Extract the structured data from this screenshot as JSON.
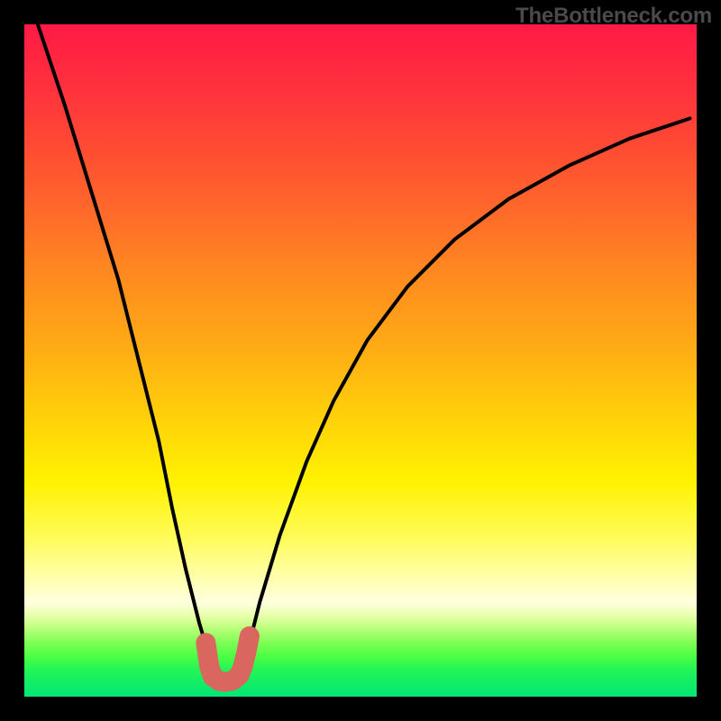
{
  "watermark": "TheBottleneck.com",
  "colors": {
    "curve": "#000000",
    "marker": "#d9675f",
    "frame": "#000000"
  },
  "chart_data": {
    "type": "line",
    "title": "",
    "xlabel": "",
    "ylabel": "",
    "xlim": [
      0,
      100
    ],
    "ylim": [
      0,
      100
    ],
    "series": [
      {
        "name": "bottleneck-curve",
        "x": [
          2,
          6,
          10,
          14,
          17,
          20,
          22,
          24,
          26,
          27.5,
          29,
          30,
          31,
          32,
          33.5,
          35,
          38,
          42,
          46,
          51,
          57,
          64,
          72,
          81,
          90,
          99
        ],
        "y": [
          100,
          88,
          75,
          62,
          50,
          38,
          28,
          19,
          11,
          6,
          3,
          2.2,
          2.6,
          4,
          8,
          14,
          24,
          35,
          44,
          53,
          61,
          68,
          74,
          79,
          83,
          86
        ]
      },
      {
        "name": "optimal-region-marker",
        "x": [
          27,
          27.5,
          28,
          29,
          30,
          31,
          32,
          32.5,
          33,
          33.5
        ],
        "y": [
          8,
          4.5,
          3,
          2.3,
          2.2,
          2.4,
          3.2,
          4.5,
          6.5,
          9
        ]
      }
    ],
    "note": "V-shaped bottleneck curve on a rainbow gradient background. Minimum (green/ideal) occurs around x≈29-31. Pink marker highlights the near-optimal basin around the minimum."
  }
}
